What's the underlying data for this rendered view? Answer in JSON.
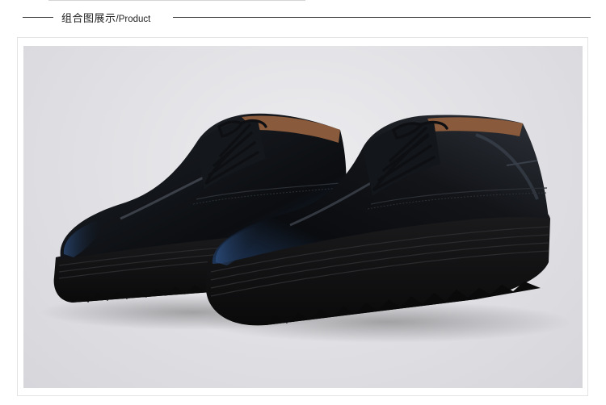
{
  "section_header": {
    "title_cn": "组合图展示",
    "title_en": "/Product"
  },
  "photo": {
    "subject": "pair-of-black-patent-leather-platform-derby-shoes",
    "background_color": "#dfdfe3",
    "shoe_color": "#0f1216",
    "accent_color": "#1d3558",
    "lining_color": "#8a5a3c"
  }
}
